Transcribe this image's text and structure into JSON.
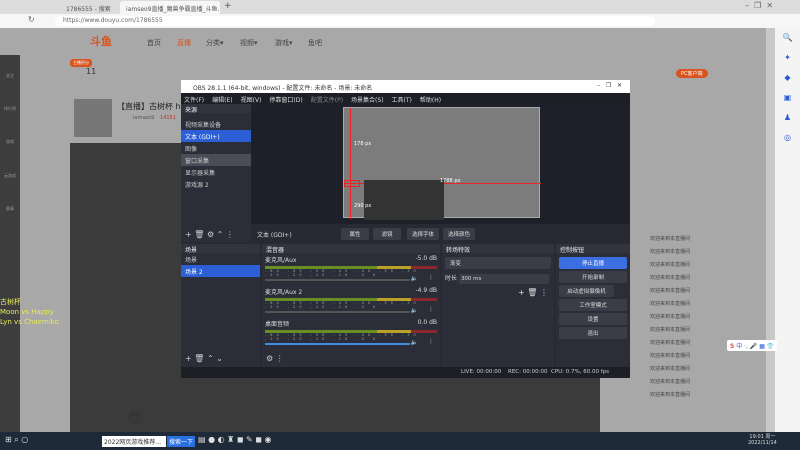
{
  "browser": {
    "tabs": [
      "1786555 - 搜索",
      "iamseo9直播_魔兽争霸直播_斗鱼..."
    ],
    "url": "https://www.douyu.com/1786555"
  },
  "douyu": {
    "logo": "斗鱼",
    "nav": [
      "首页",
      "直播",
      "分类▾",
      "视频▾",
      "游戏▾",
      "鱼吧"
    ],
    "sidebar": [
      "关注",
      "排行榜",
      "游戏",
      "云游戏",
      "赛事"
    ],
    "room_title": "【直播】古树杯 happ",
    "streamer": "iamseo9",
    "heat": "14151",
    "stats": {
      "level_badge": "主播积分",
      "level_value": "11"
    },
    "pc_badge": "PC客户端",
    "overlay": [
      "古树杯",
      "Moon vs Happy",
      "Lyn vs Chaemiko"
    ],
    "chat": [
      "欢迎来到本直播间",
      "欢迎来到本直播间",
      "欢迎来到本直播间",
      "欢迎来到本直播间",
      "欢迎来到本直播间",
      "欢迎来到本直播间",
      "欢迎来到本直播间",
      "欢迎来到本直播间",
      "欢迎来到本直播间",
      "欢迎来到本直播间",
      "欢迎来到本直播间",
      "欢迎来到本直播间",
      "欢迎来到本直播间"
    ]
  },
  "obs": {
    "title": "OBS 28.1.1 (64-bit, windows) - 配置文件: 未命名 - 场景: 未命名",
    "menu": [
      "文件(F)",
      "编辑(E)",
      "视图(V)",
      "停靠窗口(D)",
      "配置文件(P)",
      "场景集合(S)",
      "工具(T)",
      "帮助(H)"
    ],
    "sources_header": "来源",
    "sources": [
      "视频采集设备",
      "文本 (GDI+)",
      "图像",
      "窗口采集",
      "显示器采集",
      "游戏源 2"
    ],
    "preview": {
      "top": "178 px",
      "right": "1788 px",
      "bottom": "290 px"
    },
    "source_toolbar": {
      "selected": "文本 (GDI+)",
      "props": "属性",
      "filters": "滤镜",
      "font": "选择字体",
      "color": "选择颜色"
    },
    "scenes_header": "场景",
    "scenes": [
      "场景",
      "场景 2"
    ],
    "mixer_header": "混音器",
    "mixer": [
      {
        "name": "麦克风/Aux",
        "db": "-5.0 dB"
      },
      {
        "name": "麦克风/Aux 2",
        "db": "-4.9 dB"
      },
      {
        "name": "桌面音频",
        "db": "0.0 dB"
      }
    ],
    "ticks": "-60 -55 -50 -45 -40 -35 -30 -25 -20 -15 -10 -5 0",
    "transitions_header": "转场特效",
    "transition": "渐变",
    "duration_label": "时长",
    "duration": "300 ms",
    "controls_header": "控制按钮",
    "controls": [
      "停止直播",
      "开始录制",
      "启动虚拟摄像机",
      "工作室模式",
      "设置",
      "退出"
    ],
    "status": {
      "live": "LIVE: 00:00:00",
      "rec": "REC: 00:00:00",
      "cpu": "CPU: 0.7%, 60.00 fps"
    }
  },
  "taskbar": {
    "search_box": "2022网页游戏推荐...",
    "search_btn": "搜索一下",
    "time": "19:01 周一",
    "date": "2022/11/14"
  }
}
